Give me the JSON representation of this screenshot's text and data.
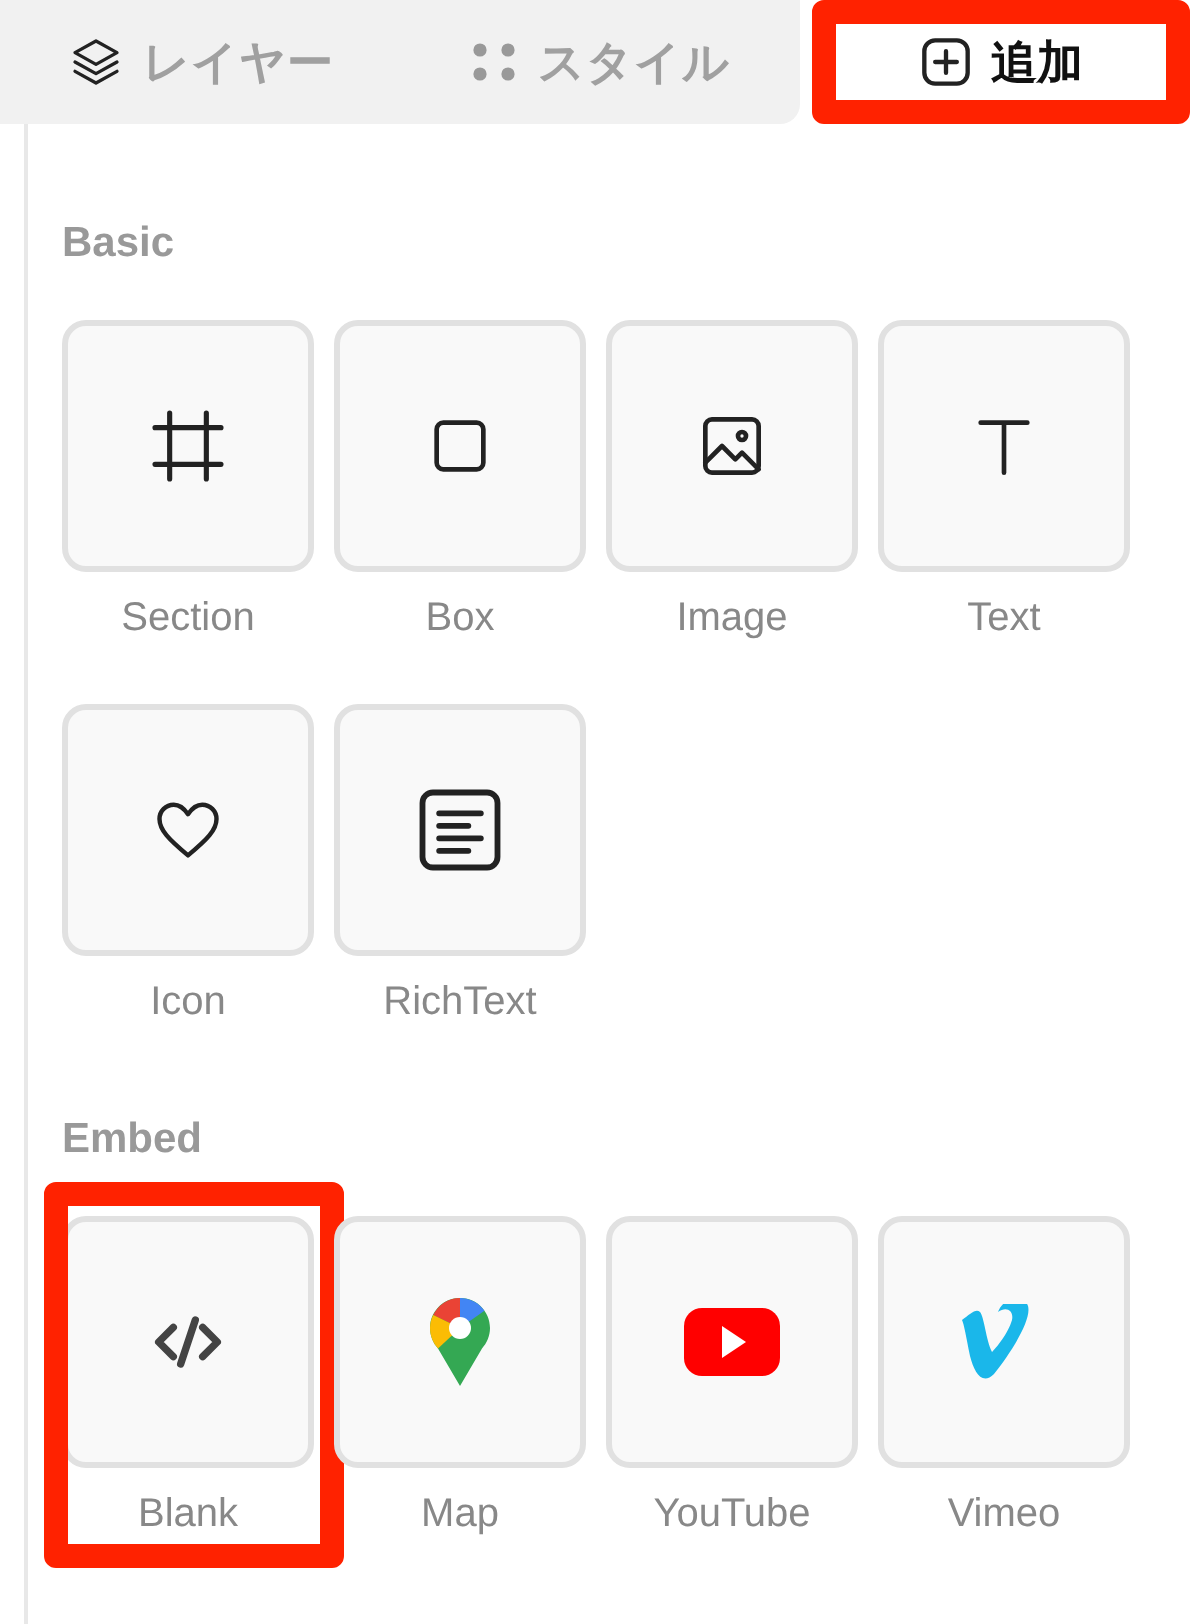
{
  "tabs": [
    {
      "label": "レイヤー",
      "selected": false,
      "highlighted": false
    },
    {
      "label": "スタイル",
      "selected": false,
      "highlighted": false
    },
    {
      "label": "追加",
      "selected": true,
      "highlighted": true
    }
  ],
  "sections": [
    {
      "title": "Basic",
      "items": [
        {
          "label": "Section",
          "highlighted": false
        },
        {
          "label": "Box",
          "highlighted": false
        },
        {
          "label": "Image",
          "highlighted": false
        },
        {
          "label": "Text",
          "highlighted": false
        },
        {
          "label": "Icon",
          "highlighted": false
        },
        {
          "label": "RichText",
          "highlighted": false
        }
      ]
    },
    {
      "title": "Embed",
      "items": [
        {
          "label": "Blank",
          "highlighted": true
        },
        {
          "label": "Map",
          "highlighted": false
        },
        {
          "label": "YouTube",
          "highlighted": false
        },
        {
          "label": "Vimeo",
          "highlighted": false
        }
      ]
    }
  ]
}
